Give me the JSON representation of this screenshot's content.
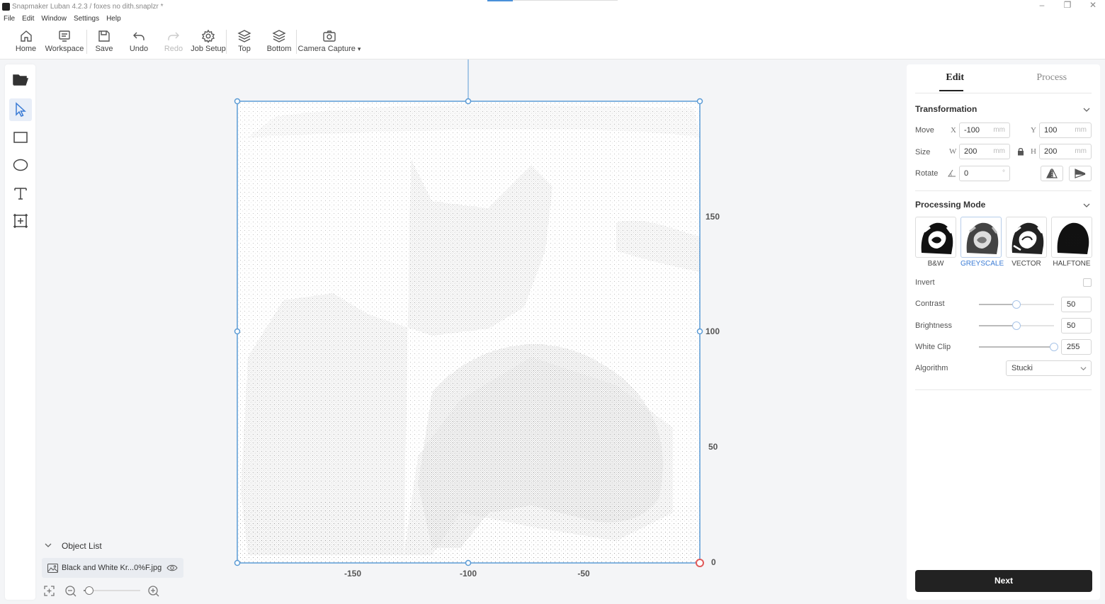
{
  "window": {
    "title": "Snapmaker Luban 4.2.3 / foxes no dith.snaplzr *",
    "controls": [
      "–",
      "❐",
      "✕"
    ]
  },
  "menu": [
    "File",
    "Edit",
    "Window",
    "Settings",
    "Help"
  ],
  "toolbar": {
    "home": "Home",
    "workspace": "Workspace",
    "save": "Save",
    "undo": "Undo",
    "redo": "Redo",
    "job_setup": "Job Setup",
    "top": "Top",
    "bottom": "Bottom",
    "camera_capture": "Camera Capture",
    "camera_caret": "▾"
  },
  "left_tools": [
    "open-file-icon",
    "select-pointer-icon",
    "rectangle-icon",
    "ellipse-icon",
    "text-icon",
    "add-frame-icon"
  ],
  "canvas": {
    "x_ticks": [
      "-150",
      "-100",
      "-50"
    ],
    "y_ticks": [
      "150",
      "100",
      "50",
      "0"
    ],
    "accent": "#5b9bd5",
    "origin_color": "#e05a5a"
  },
  "object_list": {
    "title": "Object List",
    "items": [
      {
        "name": "Black and White Kr...0%F.jpg"
      }
    ]
  },
  "zoom": {
    "level": 0.1
  },
  "panel": {
    "tabs": [
      "Edit",
      "Process"
    ],
    "transformation": {
      "title": "Transformation",
      "move_label": "Move",
      "size_label": "Size",
      "rotate_label": "Rotate",
      "x_label": "X",
      "y_label": "Y",
      "w_label": "W",
      "h_label": "H",
      "x": "-100",
      "y": "100",
      "w": "200",
      "h": "200",
      "rotate": "0",
      "unit": "mm",
      "deg": "°"
    },
    "processing_mode": {
      "title": "Processing Mode",
      "modes": [
        "B&W",
        "GREYSCALE",
        "VECTOR",
        "HALFTONE"
      ],
      "selected": "GREYSCALE",
      "invert_label": "Invert",
      "contrast_label": "Contrast",
      "contrast": "50",
      "contrast_value": 50,
      "brightness_label": "Brightness",
      "brightness": "50",
      "brightness_value": 50,
      "white_clip_label": "White Clip",
      "white_clip": "255",
      "white_clip_value": 255,
      "algorithm_label": "Algorithm",
      "algorithm": "Stucki"
    },
    "next": "Next"
  }
}
